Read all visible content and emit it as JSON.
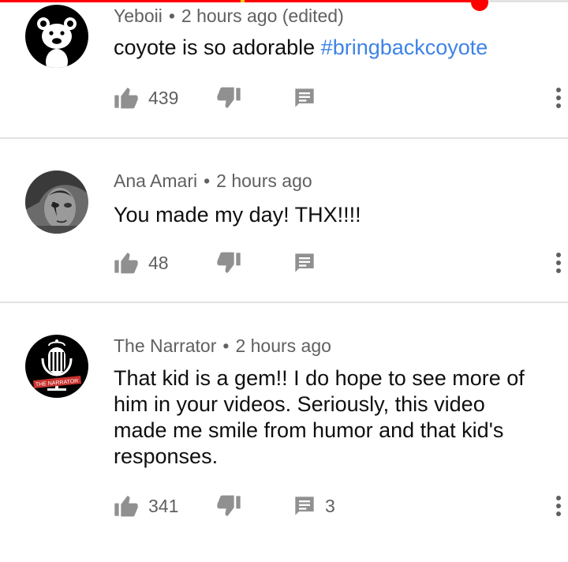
{
  "comments": [
    {
      "author": "Yeboii",
      "time": "2 hours ago (edited)",
      "text": "coyote is so adorable ",
      "hashtag": "#bringbackcoyote",
      "likes": "439",
      "replies": "",
      "avatar_icon": "bear-avatar-icon"
    },
    {
      "author": "Ana Amari",
      "time": "2 hours ago",
      "text": "You made my day! THX!!!!",
      "likes": "48",
      "replies": "",
      "avatar_icon": "portrait-avatar-icon"
    },
    {
      "author": "The Narrator",
      "time": "2 hours ago",
      "text": "That kid is a gem!! I do hope to see more of him in your videos. Seriously, this video made me smile from humor and that kid's responses.",
      "likes": "341",
      "replies": "3",
      "avatar_icon": "microphone-avatar-icon",
      "avatar_text": "THE NARRATOR"
    }
  ],
  "meta_separator": "•",
  "player": {
    "progress_fraction": 0.845
  },
  "colors": {
    "accent": "#ff0000",
    "hashtag": "#3e83e6",
    "meta": "#606060",
    "icon": "#909090"
  }
}
